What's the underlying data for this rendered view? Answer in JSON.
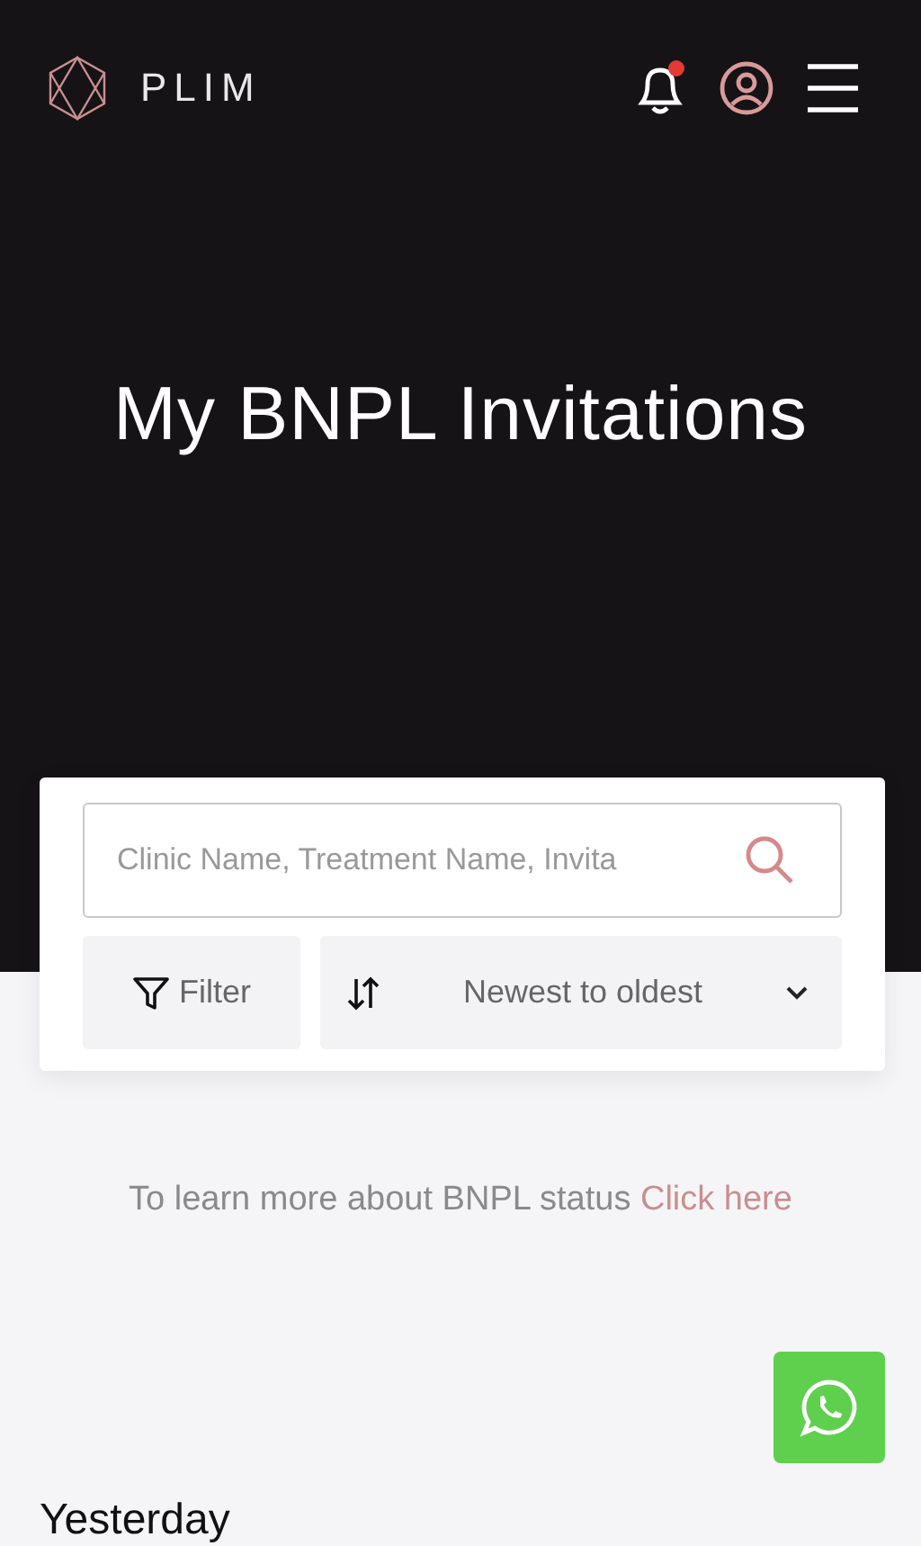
{
  "header": {
    "logo_text": "PLIM",
    "notifications": {
      "unread": true
    }
  },
  "title": "My BNPL Invitations",
  "search": {
    "placeholder": "Clinic Name, Treatment Name, Invita"
  },
  "filter_button": {
    "label": "Filter"
  },
  "sort": {
    "value": "Newest to oldest"
  },
  "info": {
    "text": "To learn more about BNPL status",
    "link": "Click here"
  },
  "section_heading": "Yesterday"
}
